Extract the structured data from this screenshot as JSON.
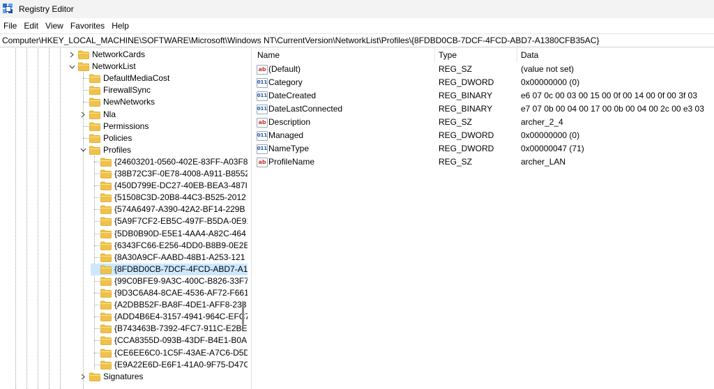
{
  "window": {
    "title": "Registry Editor",
    "icon": "registry-editor-icon"
  },
  "menu": [
    "File",
    "Edit",
    "View",
    "Favorites",
    "Help"
  ],
  "address": {
    "value": "Computer\\HKEY_LOCAL_MACHINE\\SOFTWARE\\Microsoft\\Windows NT\\CurrentVersion\\NetworkList\\Profiles\\{8FDBD0CB-7DCF-4FCD-ABD7-A1380CFB35AC}"
  },
  "tree": {
    "items": [
      {
        "label": "NetworkCards",
        "chevron": "right"
      },
      {
        "label": "NetworkList",
        "chevron": "down"
      },
      {
        "label": "DefaultMediaCost",
        "chevron": ""
      },
      {
        "label": "FirewallSync",
        "chevron": ""
      },
      {
        "label": "NewNetworks",
        "chevron": ""
      },
      {
        "label": "Nla",
        "chevron": "right"
      },
      {
        "label": "Permissions",
        "chevron": ""
      },
      {
        "label": "Policies",
        "chevron": ""
      },
      {
        "label": "Profiles",
        "chevron": "down"
      },
      {
        "label": "{24603201-0560-402E-83FF-A03F8",
        "chevron": ""
      },
      {
        "label": "{38B72C3F-0E78-4008-A911-B8552",
        "chevron": ""
      },
      {
        "label": "{450D799E-DC27-40EB-BEA3-487I",
        "chevron": ""
      },
      {
        "label": "{51508C3D-20B8-44C3-B525-2012",
        "chevron": ""
      },
      {
        "label": "{574A6497-A390-42A2-BF14-229B",
        "chevron": ""
      },
      {
        "label": "{5A9F7CF2-EB5C-497F-B5DA-0E91",
        "chevron": ""
      },
      {
        "label": "{5DB0B90D-E5E1-4AA4-A82C-464",
        "chevron": ""
      },
      {
        "label": "{6343FC66-E256-4DD0-B8B9-0E2E",
        "chevron": ""
      },
      {
        "label": "{8A30A9CF-AABD-48B1-A253-121",
        "chevron": ""
      },
      {
        "label": "{8FDBD0CB-7DCF-4FCD-ABD7-A1",
        "chevron": "",
        "selected": true
      },
      {
        "label": "{99C0BFE9-9A3C-400C-B826-33F7",
        "chevron": ""
      },
      {
        "label": "{9D3C6A84-8CAE-4536-AF72-F661",
        "chevron": ""
      },
      {
        "label": "{A2DBB52F-BA8F-4DE1-AFF8-233",
        "chevron": ""
      },
      {
        "label": "{ADD4B6E4-3157-4941-964C-EFC7",
        "chevron": ""
      },
      {
        "label": "{B743463B-7392-4FC7-911C-E2BE",
        "chevron": ""
      },
      {
        "label": "{CCA8355D-093B-43DF-B4E1-B0A",
        "chevron": ""
      },
      {
        "label": "{CE6EE6C0-1C5F-43AE-A7C6-D5D",
        "chevron": ""
      },
      {
        "label": "{E9A22E6D-E6F1-41A0-9F75-D47C",
        "chevron": ""
      },
      {
        "label": "Signatures",
        "chevron": "right"
      }
    ]
  },
  "values": {
    "headers": {
      "name": "Name",
      "type": "Type",
      "data": "Data"
    },
    "rows": [
      {
        "name": "(Default)",
        "type": "REG_SZ",
        "data": "(value not set)",
        "icon": "string-value-icon",
        "glyph": "ab"
      },
      {
        "name": "Category",
        "type": "REG_DWORD",
        "data": "0x00000000 (0)",
        "icon": "binary-value-icon",
        "glyph": "011"
      },
      {
        "name": "DateCreated",
        "type": "REG_BINARY",
        "data": "e6 07 0c 00 03 00 15 00 0f 00 14 00 0f 00 3f 03",
        "icon": "binary-value-icon",
        "glyph": "011"
      },
      {
        "name": "DateLastConnected",
        "type": "REG_BINARY",
        "data": "e7 07 0b 00 04 00 17 00 0b 00 04 00 2c 00 e3 03",
        "icon": "binary-value-icon",
        "glyph": "011"
      },
      {
        "name": "Description",
        "type": "REG_SZ",
        "data": "archer_2_4",
        "icon": "string-value-icon",
        "glyph": "ab"
      },
      {
        "name": "Managed",
        "type": "REG_DWORD",
        "data": "0x00000000 (0)",
        "icon": "binary-value-icon",
        "glyph": "011"
      },
      {
        "name": "NameType",
        "type": "REG_DWORD",
        "data": "0x00000047 (71)",
        "icon": "binary-value-icon",
        "glyph": "011"
      },
      {
        "name": "ProfileName",
        "type": "REG_SZ",
        "data": "archer_LAN",
        "icon": "string-value-icon",
        "glyph": "ab"
      }
    ]
  },
  "colors": {
    "selection": "#cce8ff",
    "folder": "#f0c24b",
    "titlebar": "#f3f3f3"
  }
}
